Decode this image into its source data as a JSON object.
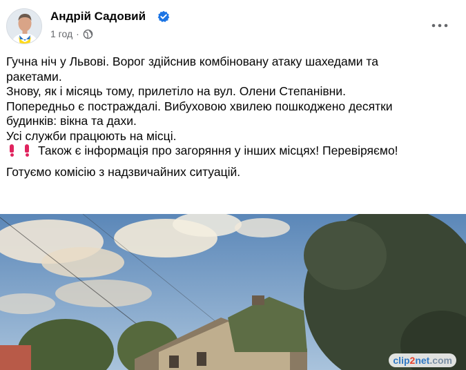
{
  "post": {
    "author": "Андрій Садовий",
    "time": "1 год",
    "dot": "·",
    "lines": [
      "Гучна ніч у Львові. Ворог здійснив комбіновану атаку шахедами та ракетами.",
      "Знову, як і місяць тому, прилетіло на вул. Олени Степанівни.",
      "Попередньо є постраждалі. Вибуховою хвилею пошкоджено десятки будинків: вікна та дахи.",
      "Усі служби працюють на місці."
    ],
    "alert_line": "Також є інформація про загоряння у інших місцях! Перевіряємо!",
    "closing_line": "Готуємо комісію з надзвичайних ситуацій."
  },
  "watermark": {
    "part1": "clip",
    "part2": "2",
    "part3": "net",
    "part4": ".com"
  },
  "colors": {
    "verified": "#1b74e4",
    "secondary_text": "#65676b",
    "alert": "#e0245e"
  },
  "icons": [
    "verified-badge-icon",
    "globe-icon",
    "more-options-icon",
    "exclamation-icon"
  ]
}
